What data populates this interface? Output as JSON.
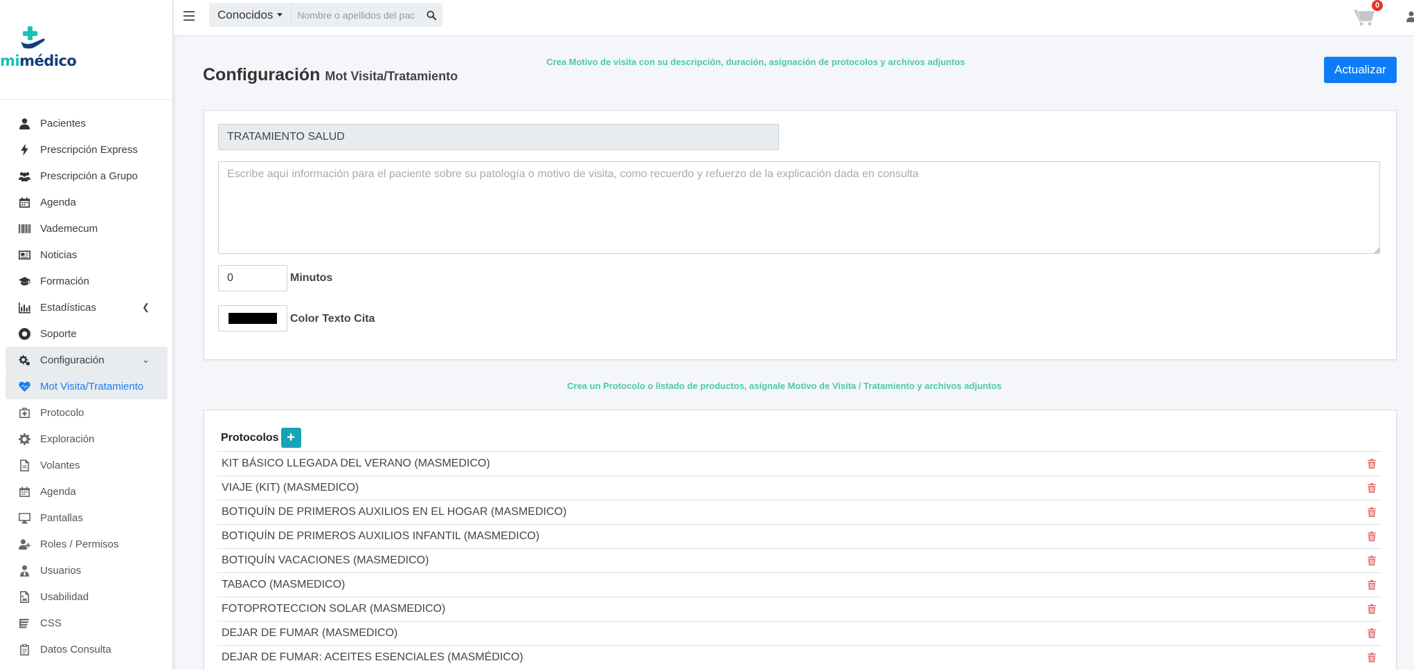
{
  "brand": {
    "logo_mi": "mi",
    "logo_medico": "médico"
  },
  "sidebar": {
    "items": [
      {
        "label": "Pacientes",
        "icon": "user-icon"
      },
      {
        "label": "Prescripción Express",
        "icon": "bolt-icon"
      },
      {
        "label": "Prescripción a Grupo",
        "icon": "users-icon"
      },
      {
        "label": "Agenda",
        "icon": "calendar-icon"
      },
      {
        "label": "Vademecum",
        "icon": "barcode-icon"
      },
      {
        "label": "Noticias",
        "icon": "newspaper-icon"
      },
      {
        "label": "Formación",
        "icon": "graduation-cap-icon"
      },
      {
        "label": "Estadísticas",
        "icon": "bar-chart-icon"
      },
      {
        "label": "Soporte",
        "icon": "life-ring-icon"
      },
      {
        "label": "Configuración",
        "icon": "cogs-icon"
      },
      {
        "label": "Mot Visita/Tratamiento",
        "icon": "heartbeat-icon"
      },
      {
        "label": "Protocolo",
        "icon": "medkit-icon"
      },
      {
        "label": "Exploración",
        "icon": "gear-icon"
      },
      {
        "label": "Volantes",
        "icon": "file-icon"
      },
      {
        "label": "Agenda",
        "icon": "calendar-icon"
      },
      {
        "label": "Pantallas",
        "icon": "desktop-icon"
      },
      {
        "label": "Roles / Permisos",
        "icon": "user-plus-icon"
      },
      {
        "label": "Usuarios",
        "icon": "user-tie-icon"
      },
      {
        "label": "Usabilidad",
        "icon": "image-icon"
      },
      {
        "label": "CSS",
        "icon": "css-icon"
      },
      {
        "label": "Datos Consulta",
        "icon": "clipboard-icon"
      }
    ]
  },
  "topbar": {
    "filter_label": "Conocidos",
    "search_placeholder": "Nombre o apellidos del paciente",
    "cart_count": "0"
  },
  "page": {
    "title": "Configuración",
    "subtitle": "Mot Visita/Tratamiento",
    "hint_top": "Crea Motivo de visita con su descripción, duración, asignación de protocolos y archivos adjuntos",
    "update_label": "Actualizar",
    "hint_middle": "Crea un Protocolo o listado de productos, asígnale Motivo de Visita / Tratamiento y archivos adjuntos"
  },
  "form": {
    "name_value": "TRATAMIENTO SALUD",
    "description_placeholder": "Escribe aquí información para el paciente sobre su patología o motivo de visita, como recuerdo y refuerzo de la explicación dada en consulta",
    "minutes_value": "0",
    "minutes_label": "Minutos",
    "color_value": "#000000",
    "color_label": "Color Texto Cita"
  },
  "protocols": {
    "title": "Protocolos",
    "add_label": "+",
    "rows": [
      "KIT BÁSICO LLEGADA DEL VERANO (MASMEDICO)",
      "VIAJE (KIT) (MASMEDICO)",
      "BOTIQUÍN DE PRIMEROS AUXILIOS EN EL HOGAR (MASMEDICO)",
      "BOTIQUÍN DE PRIMEROS AUXILIOS INFANTIL (MASMEDICO)",
      "BOTIQUÍN VACACIONES (MASMEDICO)",
      "TABACO (MASMEDICO)",
      "FOTOPROTECCION SOLAR (MASMEDICO)",
      "DEJAR DE FUMAR (MASMEDICO)",
      "DEJAR DE FUMAR: ACEITES ESENCIALES (MASMÉDICO)"
    ]
  },
  "colors": {
    "accent": "#1a7cf0",
    "hint": "#4bcaa6",
    "add_button": "#17a2b8",
    "trash": "#e57373"
  }
}
